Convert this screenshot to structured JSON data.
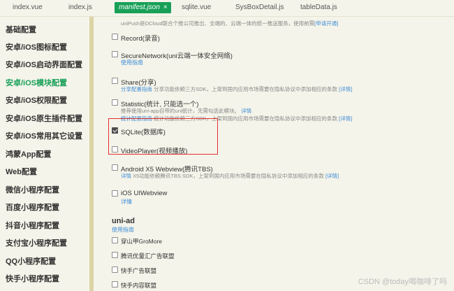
{
  "tabs": [
    {
      "label": "index.vue"
    },
    {
      "label": "index.js"
    },
    {
      "label": "manifest.json",
      "close": "×"
    },
    {
      "label": "sqlite.vue"
    },
    {
      "label": "SysBoxDetail.js"
    },
    {
      "label": "tableData.js"
    }
  ],
  "sidebar": {
    "items": [
      {
        "label": "基础配置"
      },
      {
        "label": "安卓/iOS图标配置"
      },
      {
        "label": "安卓/iOS启动界面配置"
      },
      {
        "label": "安卓/iOS模块配置"
      },
      {
        "label": "安卓/iOS权限配置"
      },
      {
        "label": "安卓/iOS原生插件配置"
      },
      {
        "label": "安卓/iOS常用其它设置"
      },
      {
        "label": "鸿蒙App配置"
      },
      {
        "label": "Web配置"
      },
      {
        "label": "微信小程序配置"
      },
      {
        "label": "百度小程序配置"
      },
      {
        "label": "抖音小程序配置"
      },
      {
        "label": "支付宝小程序配置"
      },
      {
        "label": "QQ小程序配置"
      },
      {
        "label": "快手小程序配置"
      }
    ]
  },
  "notice": {
    "text": "uniPush是DCloud联合个推公司推出、全端的、云端一体的统一推送服务，使用前需",
    "link": "[申请开通]"
  },
  "modules": {
    "record": {
      "title": "Record(录音)"
    },
    "secure": {
      "title": "SecureNetwork(uni云端一体安全网络)",
      "link": "使用指南"
    },
    "share": {
      "title": "Share(分享)",
      "link": "分享配置指南",
      "desc": "分享功能依赖三方SDK，上架到国内应用市场需要在隐私协议中添加相应的条款",
      "detail": "[详情]"
    },
    "statistic": {
      "title": "Statistic(统计, 只能选一个)",
      "desc1": "推荐使用uni-app自带的uni统计，无需勾选此模块。",
      "link1": "详情",
      "link2": "统计配置指南",
      "desc2": "统计功能依赖三方SDK，上架到国内应用市场需要在隐私协议中添加相应的条款",
      "detail": "[详情]"
    },
    "sqlite": {
      "title": "SQLite(数据库)"
    },
    "videoplayer": {
      "title": "VideoPlayer(视频播放)"
    },
    "x5": {
      "title": "Android X5 Webview(腾讯TBS)",
      "link": "详情",
      "desc": "X5功能依赖腾讯TBS SDK，上架到国内应用市场需要在隐私协议中添加相应的条款",
      "detail": "[详情]"
    },
    "uiwebview": {
      "title": "iOS UIWebview",
      "link": "详情"
    }
  },
  "uniad": {
    "title": "uni-ad",
    "link": "使用指南",
    "items": [
      {
        "label": "穿山甲GroMore"
      },
      {
        "label": "腾讯优量汇广告联盟"
      },
      {
        "label": "快手广告联盟"
      },
      {
        "label": "快手内容联盟"
      }
    ]
  },
  "watermark": "CSDN @today喝咖啡了吗"
}
